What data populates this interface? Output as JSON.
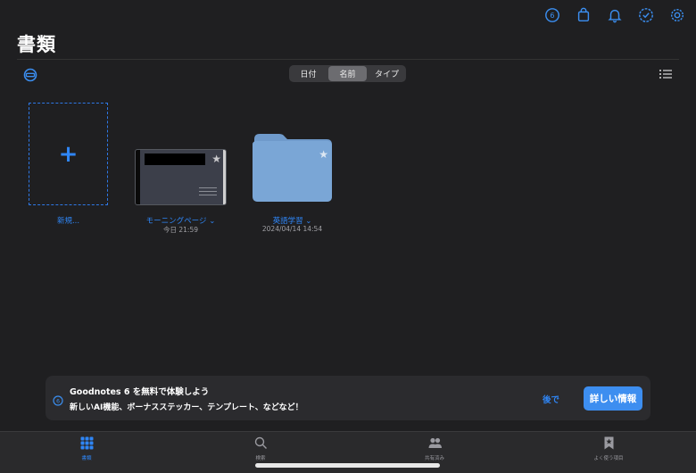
{
  "top_icons": [
    "goodnotes-6-icon",
    "shopping-bag-icon",
    "bell-icon",
    "checkmark-circle-icon",
    "gear-icon"
  ],
  "page_title": "書類",
  "sort": {
    "options": [
      "日付",
      "名前",
      "タイプ"
    ],
    "selected": "名前"
  },
  "items": [
    {
      "name": "新規...",
      "type": "new"
    },
    {
      "name": "モーニングページ ⌄",
      "date": "今日 21:59",
      "type": "notebook"
    },
    {
      "name": "英語学習 ⌄",
      "date": "2024/04/14 14:54",
      "type": "folder"
    }
  ],
  "banner": {
    "title": "Goodnotes 6 を無料で体験しよう",
    "subtitle": "新しいAI機能、ボーナスステッカー、テンプレート、などなど！",
    "later": "後で",
    "details": "詳しい情報"
  },
  "tabs": [
    {
      "label": "書類",
      "active": true
    },
    {
      "label": "検索",
      "active": false
    },
    {
      "label": "共有済み",
      "active": false
    },
    {
      "label": "よく使う項目",
      "active": false
    }
  ],
  "colors": {
    "accent": "#2f86f6",
    "background": "#1f1f21",
    "folder": "#6f9acb"
  }
}
